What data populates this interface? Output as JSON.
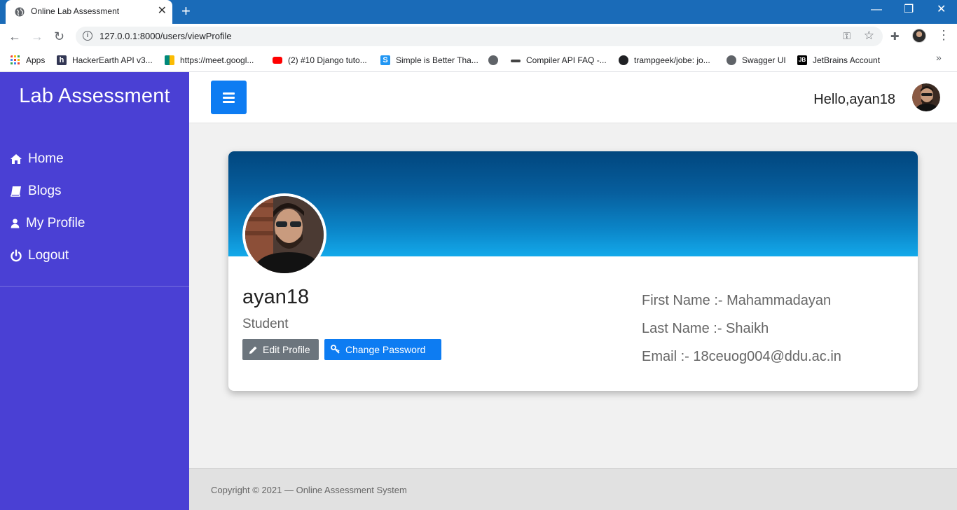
{
  "browser": {
    "tab_title": "Online Lab Assessment",
    "tab_close": "✕",
    "new_tab": "+",
    "window_controls": [
      "—",
      "❐",
      "✕"
    ],
    "url": "127.0.0.1:8000/users/viewProfile",
    "bookmarks": [
      {
        "label": "Apps",
        "icon": "apps-grid-icon",
        "color": "#ea4335"
      },
      {
        "label": "HackerEarth API v3...",
        "icon": "hackerearth-icon",
        "color": "#323754"
      },
      {
        "label": "https://meet.googl...",
        "icon": "google-meet-icon",
        "color": "#00897b"
      },
      {
        "label": "(2) #10 Django tuto...",
        "icon": "youtube-icon",
        "color": "#ff0000"
      },
      {
        "label": "Simple is Better Tha...",
        "icon": "s-logo-icon",
        "color": "#2196f3"
      },
      {
        "label": "",
        "icon": "globe-icon",
        "color": "#5f6368"
      },
      {
        "label": "Compiler API FAQ -...",
        "icon": "compiler-icon",
        "color": "#444444"
      },
      {
        "label": "trampgeek/jobe: jo...",
        "icon": "github-icon",
        "color": "#202124"
      },
      {
        "label": "Swagger UI",
        "icon": "globe-icon",
        "color": "#5f6368"
      },
      {
        "label": "JetBrains Account",
        "icon": "jetbrains-icon",
        "color": "#000000"
      }
    ],
    "bookmarks_more": "»"
  },
  "sidebar": {
    "brand": "Lab Assessment",
    "items": [
      {
        "label": "Home",
        "icon": "home-icon"
      },
      {
        "label": "Blogs",
        "icon": "book-icon"
      },
      {
        "label": "My Profile",
        "icon": "user-icon"
      },
      {
        "label": "Logout",
        "icon": "power-icon"
      }
    ],
    "color": "#4a40d4"
  },
  "topbar": {
    "greeting": "Hello,ayan18"
  },
  "profile": {
    "username": "ayan18",
    "role": "Student",
    "edit_label": "Edit Profile",
    "change_password_label": "Change Password",
    "first_name": "First Name :- Mahammadayan",
    "last_name": "Last Name :- Shaikh",
    "email": "Email :- 18ceuog004@ddu.ac.in"
  },
  "footer": {
    "copyright": "Copyright © 2021 — Online Assessment System"
  },
  "colors": {
    "primary": "#0d7cf2",
    "secondary": "#6c757d",
    "banner_dark": "#01467e",
    "banner_light": "#13a9ea"
  }
}
